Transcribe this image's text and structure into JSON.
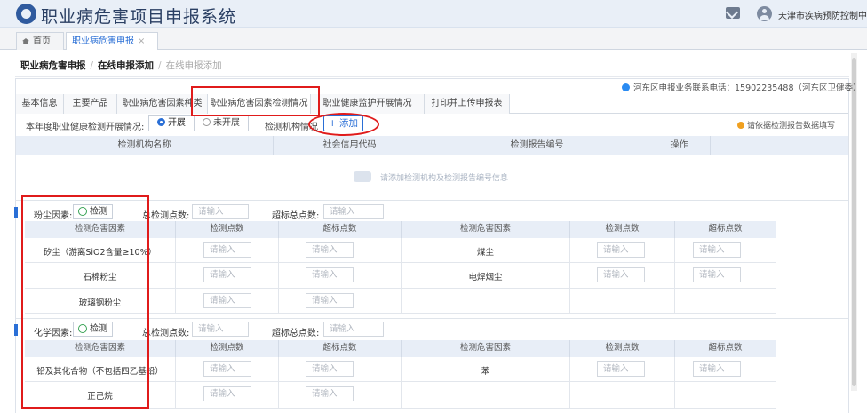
{
  "header": {
    "app_title": "职业病危害项目申报系统",
    "organization": "天津市疾病预防控制中心",
    "org_chevron": ">"
  },
  "tabs": {
    "home": "首页",
    "active": "职业病危害申报",
    "close": "×"
  },
  "breadcrumb": {
    "level1": "职业病危害申报",
    "level2": "在线申报添加",
    "level3": "在线申报添加",
    "sep": "/"
  },
  "contact_text": "河东区申报业务联系电话：15902235488（河东区卫健委）",
  "subtabs": [
    "基本信息",
    "主要产品",
    "职业病危害因素种类",
    "职业病危害因素检测情况",
    "职业健康监护开展情况",
    "打印并上传申报表"
  ],
  "detection": {
    "question": "本年度职业健康检测开展情况:",
    "option_yes": "开展",
    "option_no": "未开展",
    "org_label": "检测机构情况",
    "add_button": "+ 添加",
    "warning": "请依据检测报告数据填写"
  },
  "org_table": {
    "headers": [
      "检测机构名称",
      "社会信用代码",
      "检测报告编号",
      "操作"
    ],
    "empty_text": "请添加检测机构及检测报告编号信息"
  },
  "placeholder": "请输入",
  "grid_headers": [
    "检测危害因素",
    "检测点数",
    "超标点数",
    "检测危害因素",
    "检测点数",
    "超标点数"
  ],
  "dust": {
    "label": "粉尘因素:",
    "check": "检测",
    "total_label": "总检测点数:",
    "over_label": "超标总点数:",
    "rows": [
      {
        "left": "矽尘（游离SiO2含量≥10%）",
        "right": "煤尘"
      },
      {
        "left": "石棉粉尘",
        "right": "电焊烟尘"
      },
      {
        "left": "玻璃钢粉尘",
        "right": ""
      }
    ]
  },
  "chemical": {
    "label": "化学因素:",
    "check": "检测",
    "total_label": "总检测点数:",
    "over_label": "超标总点数:",
    "rows": [
      {
        "left": "铅及其化合物（不包括四乙基铅）",
        "right": "苯"
      },
      {
        "left": "正己烷",
        "right": ""
      }
    ]
  },
  "colors": {
    "accent": "#2a6fd6",
    "annotation": "#e01b1b",
    "header_bg": "#e9eff7"
  }
}
